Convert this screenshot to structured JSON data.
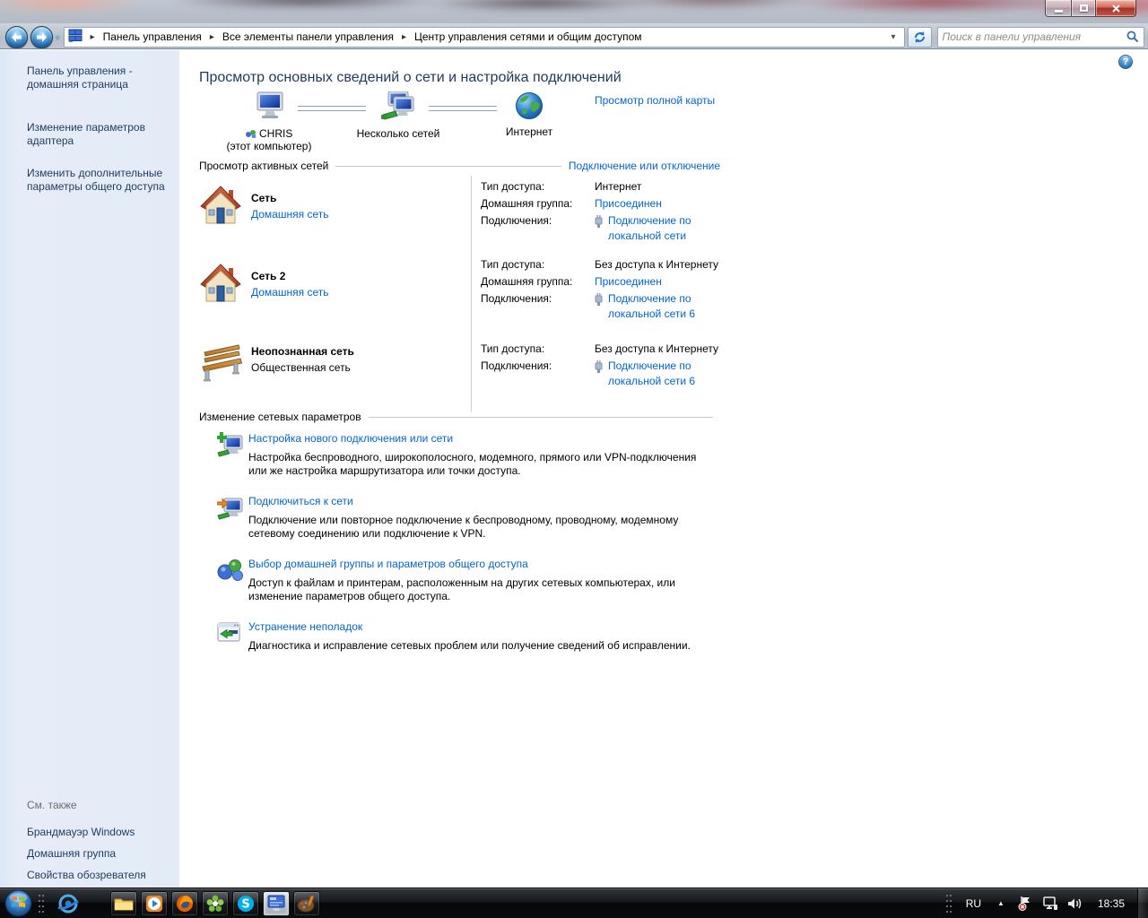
{
  "colors": {
    "link": "#0066cc",
    "heading": "#1e395b",
    "sidebar_text": "#1d3a5f"
  },
  "icons": {
    "breadcrumb_arrow": "▸",
    "dropdown_arrow": "▾",
    "tray_up_arrow": "▲",
    "help": "?"
  },
  "navbar": {
    "breadcrumb": [
      "Панель управления",
      "Все элементы панели управления",
      "Центр управления сетями и общим доступом"
    ],
    "search_placeholder": "Поиск в панели управления"
  },
  "sidebar": {
    "top_items": [
      "Панель управления - домашняя страница",
      "Изменение параметров адаптера",
      "Изменить дополнительные параметры общего доступа"
    ],
    "see_also_header": "См. также",
    "see_also_items": [
      "Брандмауэр Windows",
      "Домашняя группа",
      "Свойства обозревателя"
    ]
  },
  "main": {
    "title": "Просмотр основных сведений о сети и настройка подключений",
    "map": {
      "nodes": [
        {
          "label": "CHRIS",
          "sublabel": "(этот компьютер)"
        },
        {
          "label": "Несколько сетей"
        },
        {
          "label": "Интернет"
        }
      ],
      "full_map_link": "Просмотр полной карты"
    },
    "active_networks": {
      "header": "Просмотр активных сетей",
      "connect_link": "Подключение или отключение",
      "networks": [
        {
          "name": "Сеть",
          "type": "Домашняя сеть",
          "access_label": "Тип доступа:",
          "access": "Интернет",
          "homegroup_label": "Домашняя группа:",
          "homegroup": "Присоединен",
          "connections_label": "Подключения:",
          "connection": "Подключение по локальной сети"
        },
        {
          "name": "Сеть 2",
          "type": "Домашняя сеть",
          "access_label": "Тип доступа:",
          "access": "Без доступа к Интернету",
          "homegroup_label": "Домашняя группа:",
          "homegroup": "Присоединен",
          "connections_label": "Подключения:",
          "connection": "Подключение по локальной сети 6"
        },
        {
          "name": "Неопознанная сеть",
          "type": "Общественная сеть",
          "access_label": "Тип доступа:",
          "access": "Без доступа к Интернету",
          "connections_label": "Подключения:",
          "connection": "Подключение по локальной сети 6"
        }
      ]
    },
    "change_settings": {
      "header": "Изменение сетевых параметров",
      "items": [
        {
          "title": "Настройка нового подключения или сети",
          "desc": "Настройка беспроводного, широкополосного, модемного, прямого или VPN-подключения или же настройка маршрутизатора или точки доступа."
        },
        {
          "title": "Подключиться к сети",
          "desc": "Подключение или повторное подключение к беспроводному, проводному, модемному сетевому соединению или подключение к VPN."
        },
        {
          "title": "Выбор домашней группы и параметров общего доступа",
          "desc": "Доступ к файлам и принтерам, расположенным на других сетевых компьютерах, или изменение параметров общего доступа."
        },
        {
          "title": "Устранение неполадок",
          "desc": "Диагностика и исправление сетевых проблем или получение сведений об исправлении."
        }
      ]
    }
  },
  "taskbar": {
    "tray": {
      "language": "RU",
      "time": "18:35"
    }
  }
}
